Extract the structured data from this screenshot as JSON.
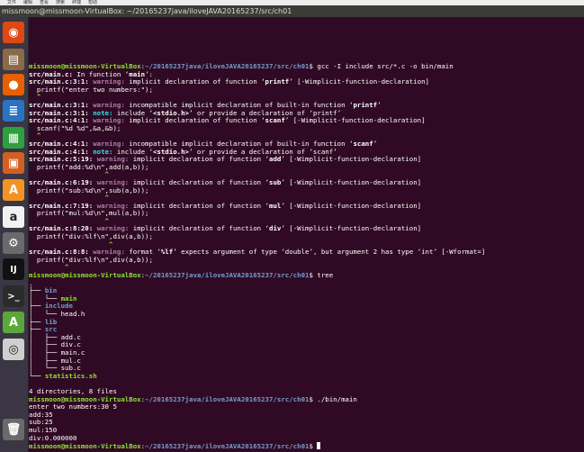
{
  "menubar": {
    "items": [
      "文件",
      "编辑",
      "查看",
      "搜索",
      "终端",
      "帮助"
    ]
  },
  "window": {
    "title": "missmoon@missmoon-VirtualBox: ~/20165237java/iloveJAVA20165237/src/ch01"
  },
  "launcher": {
    "items": [
      {
        "icon": "ubuntu-dash-icon",
        "glyph": "◉",
        "bg": "#dd4814"
      },
      {
        "icon": "files-icon",
        "glyph": "▤",
        "bg": "#8b6a4a"
      },
      {
        "icon": "firefox-icon",
        "glyph": "●",
        "bg": "#e66000"
      },
      {
        "icon": "writer-icon",
        "glyph": "≣",
        "bg": "#2a72c3"
      },
      {
        "icon": "calc-icon",
        "glyph": "▦",
        "bg": "#2f9e3f"
      },
      {
        "icon": "impress-icon",
        "glyph": "▣",
        "bg": "#d35f22"
      },
      {
        "icon": "software-center-icon",
        "glyph": "A",
        "bg": "#f29425"
      },
      {
        "icon": "amazon-icon",
        "glyph": "a",
        "bg": "#f2f2f2"
      },
      {
        "icon": "settings-icon",
        "glyph": "⚙",
        "bg": "#6a6a6a"
      },
      {
        "icon": "intellij-icon",
        "glyph": "IJ",
        "bg": "#111111"
      },
      {
        "icon": "terminal-icon",
        "glyph": ">_",
        "bg": "#2b2b2b"
      },
      {
        "icon": "updater-icon",
        "glyph": "A",
        "bg": "#5aa83a"
      },
      {
        "icon": "dvd-icon",
        "glyph": "◎",
        "bg": "#cfcfcf"
      },
      {
        "icon": "trash-icon",
        "glyph": "🗑",
        "bg": "#6a6a6a"
      }
    ]
  },
  "terminal": {
    "prompt_user": "missmoon@missmoon-VirtualBox",
    "prompt_path": "~/20165237java/iloveJAVA20165237/src/ch01",
    "lines": [
      {
        "t": "prompt",
        "cmd": " gcc -I include src/*.c -o bin/main"
      },
      {
        "t": "msg",
        "file": "src/main.c:",
        "rest": " In function ‘",
        "name": "main",
        "end": "’:"
      },
      {
        "t": "diag",
        "loc": "src/main.c:3:1:",
        "kind": "warning",
        "msg": " implicit declaration of function ‘",
        "q": "printf",
        "tail": "’ [-Wimplicit-function-declaration]"
      },
      {
        "t": "plain",
        "text": "  printf(\"enter two numbers:\");"
      },
      {
        "t": "caret",
        "text": "  ^"
      },
      {
        "t": "diag",
        "loc": "src/main.c:3:1:",
        "kind": "warning",
        "msg": " incompatible implicit declaration of built-in function ‘",
        "q": "printf",
        "tail": "’"
      },
      {
        "t": "diag",
        "loc": "src/main.c:3:1:",
        "kind": "note",
        "msg": " include ‘",
        "q": "<stdio.h>",
        "tail": "’ or provide a declaration of ‘printf’"
      },
      {
        "t": "diag",
        "loc": "src/main.c:4:1:",
        "kind": "warning",
        "msg": " implicit declaration of function ‘",
        "q": "scanf",
        "tail": "’ [-Wimplicit-function-declaration]"
      },
      {
        "t": "plain",
        "text": "  scanf(\"%d %d\",&a,&b);"
      },
      {
        "t": "caret",
        "text": "  ^"
      },
      {
        "t": "diag",
        "loc": "src/main.c:4:1:",
        "kind": "warning",
        "msg": " incompatible implicit declaration of built-in function ‘",
        "q": "scanf",
        "tail": "’"
      },
      {
        "t": "diag",
        "loc": "src/main.c:4:1:",
        "kind": "note",
        "msg": " include ‘",
        "q": "<stdio.h>",
        "tail": "’ or provide a declaration of ‘scanf’"
      },
      {
        "t": "diag",
        "loc": "src/main.c:5:19:",
        "kind": "warning",
        "msg": " implicit declaration of function ‘",
        "q": "add",
        "tail": "’ [-Wimplicit-function-declaration]"
      },
      {
        "t": "plain",
        "text": "  printf(\"add:%d\\n\",add(a,b));"
      },
      {
        "t": "caret",
        "text": "                   ^"
      },
      {
        "t": "diag",
        "loc": "src/main.c:6:19:",
        "kind": "warning",
        "msg": " implicit declaration of function ‘",
        "q": "sub",
        "tail": "’ [-Wimplicit-function-declaration]"
      },
      {
        "t": "plain",
        "text": "  printf(\"sub:%d\\n\",sub(a,b));"
      },
      {
        "t": "caret",
        "text": "                   ^"
      },
      {
        "t": "diag",
        "loc": "src/main.c:7:19:",
        "kind": "warning",
        "msg": " implicit declaration of function ‘",
        "q": "mul",
        "tail": "’ [-Wimplicit-function-declaration]"
      },
      {
        "t": "plain",
        "text": "  printf(\"mul:%d\\n\",mul(a,b));"
      },
      {
        "t": "caret",
        "text": "                   ^"
      },
      {
        "t": "diag",
        "loc": "src/main.c:8:20:",
        "kind": "warning",
        "msg": " implicit declaration of function ‘",
        "q": "div",
        "tail": "’ [-Wimplicit-function-declaration]"
      },
      {
        "t": "plain",
        "text": "  printf(\"div:%lf\\n\",div(a,b));"
      },
      {
        "t": "caret",
        "text": "                    ^"
      },
      {
        "t": "diag",
        "loc": "src/main.c:8:8:",
        "kind": "warning",
        "msg": " format ‘",
        "q": "%lf",
        "tail": "’ expects argument of type ‘double’, but argument 2 has type ‘int’ [-Wformat=]"
      },
      {
        "t": "plain",
        "text": "  printf(\"div:%lf\\n\",div(a,b));"
      },
      {
        "t": "caret",
        "text": "         ^"
      },
      {
        "t": "prompt",
        "cmd": " tree"
      },
      {
        "t": "plain",
        "text": "."
      },
      {
        "t": "tree",
        "pre": "├── ",
        "name": "bin",
        "cls": "b"
      },
      {
        "t": "tree",
        "pre": "│   └── ",
        "name": "main",
        "cls": "g"
      },
      {
        "t": "tree",
        "pre": "├── ",
        "name": "include",
        "cls": "b"
      },
      {
        "t": "tree",
        "pre": "│   └── ",
        "name": "head.h",
        "cls": ""
      },
      {
        "t": "tree",
        "pre": "├── ",
        "name": "lib",
        "cls": "b"
      },
      {
        "t": "tree",
        "pre": "├── ",
        "name": "src",
        "cls": "b"
      },
      {
        "t": "tree",
        "pre": "│   ├── ",
        "name": "add.c",
        "cls": ""
      },
      {
        "t": "tree",
        "pre": "│   ├── ",
        "name": "div.c",
        "cls": ""
      },
      {
        "t": "tree",
        "pre": "│   ├── ",
        "name": "main.c",
        "cls": ""
      },
      {
        "t": "tree",
        "pre": "│   ├── ",
        "name": "mul.c",
        "cls": ""
      },
      {
        "t": "tree",
        "pre": "│   └── ",
        "name": "sub.c",
        "cls": ""
      },
      {
        "t": "tree",
        "pre": "└── ",
        "name": "statistics.sh",
        "cls": "g"
      },
      {
        "t": "plain",
        "text": ""
      },
      {
        "t": "plain",
        "text": "4 directories, 8 files"
      },
      {
        "t": "prompt",
        "cmd": " ./bin/main"
      },
      {
        "t": "plain",
        "text": "enter two numbers:30 5"
      },
      {
        "t": "plain",
        "text": "add:35"
      },
      {
        "t": "plain",
        "text": "sub:25"
      },
      {
        "t": "plain",
        "text": "mul:150"
      },
      {
        "t": "plain",
        "text": "div:0.000000"
      },
      {
        "t": "prompt",
        "cmd": " ",
        "cursor": true
      }
    ]
  }
}
